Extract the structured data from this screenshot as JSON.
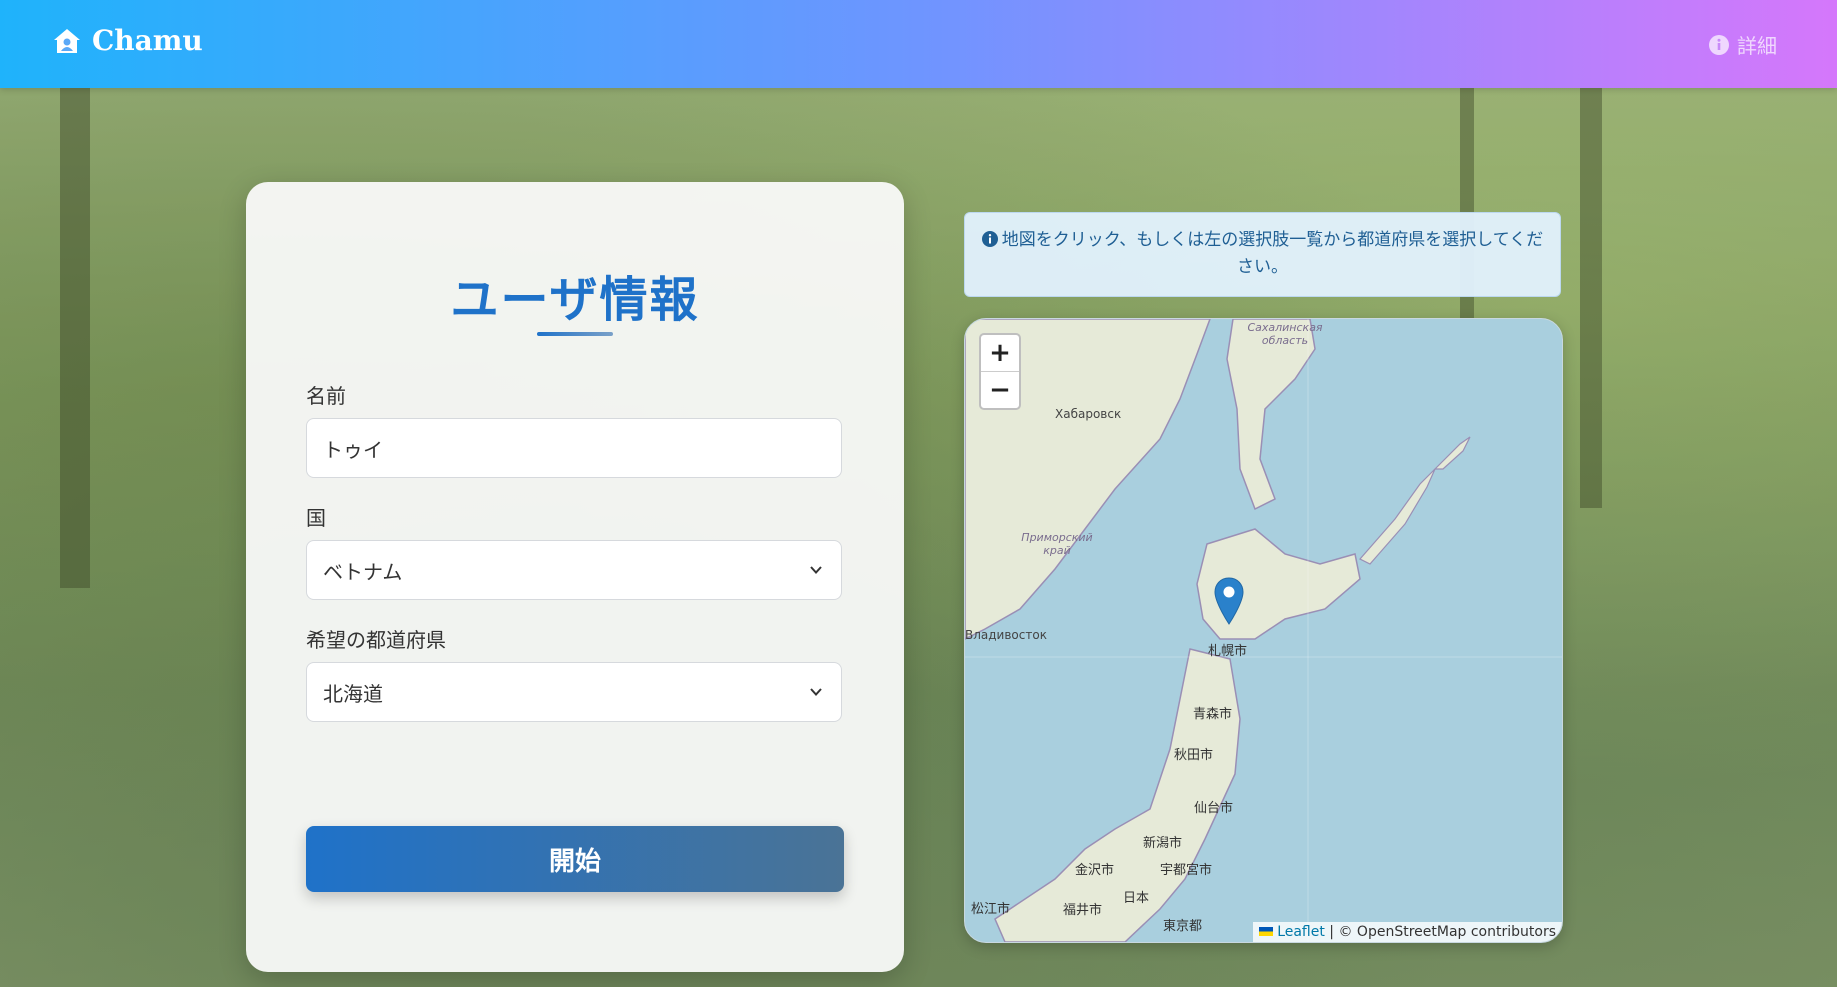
{
  "navbar": {
    "brand": "Chamu",
    "details_label": "詳細"
  },
  "form": {
    "title": "ユーザ情報",
    "name_label": "名前",
    "name_value": "トゥイ",
    "country_label": "国",
    "country_value": "ベトナム",
    "prefecture_label": "希望の都道府県",
    "prefecture_value": "北海道",
    "start_button": "開始"
  },
  "info": {
    "message": "地図をクリック、もしくは左の選択肢一覧から都道府県を選択してください。"
  },
  "map": {
    "zoom_in": "+",
    "zoom_out": "−",
    "attribution_leaflet": "Leaflet",
    "attribution_rest": " | © OpenStreetMap contributors",
    "labels": {
      "khabarovsk": "Хабаровск",
      "vladivostok": "Владивосток",
      "primorsky": "Приморский край",
      "sakhalin": "Сахалинская область",
      "sapporo": "札幌市",
      "aomori": "青森市",
      "akita": "秋田市",
      "sendai": "仙台市",
      "niigata": "新潟市",
      "kanazawa": "金沢市",
      "utsunomiya": "宇都宮市",
      "japan": "日本",
      "fukui": "福井市",
      "matsue": "松江市",
      "tokyo": "東京都"
    }
  },
  "colors": {
    "accent": "#1f72c9",
    "navbar_start": "#1fb3fb",
    "navbar_end": "#d577fb",
    "marker": "#2a81cb"
  }
}
